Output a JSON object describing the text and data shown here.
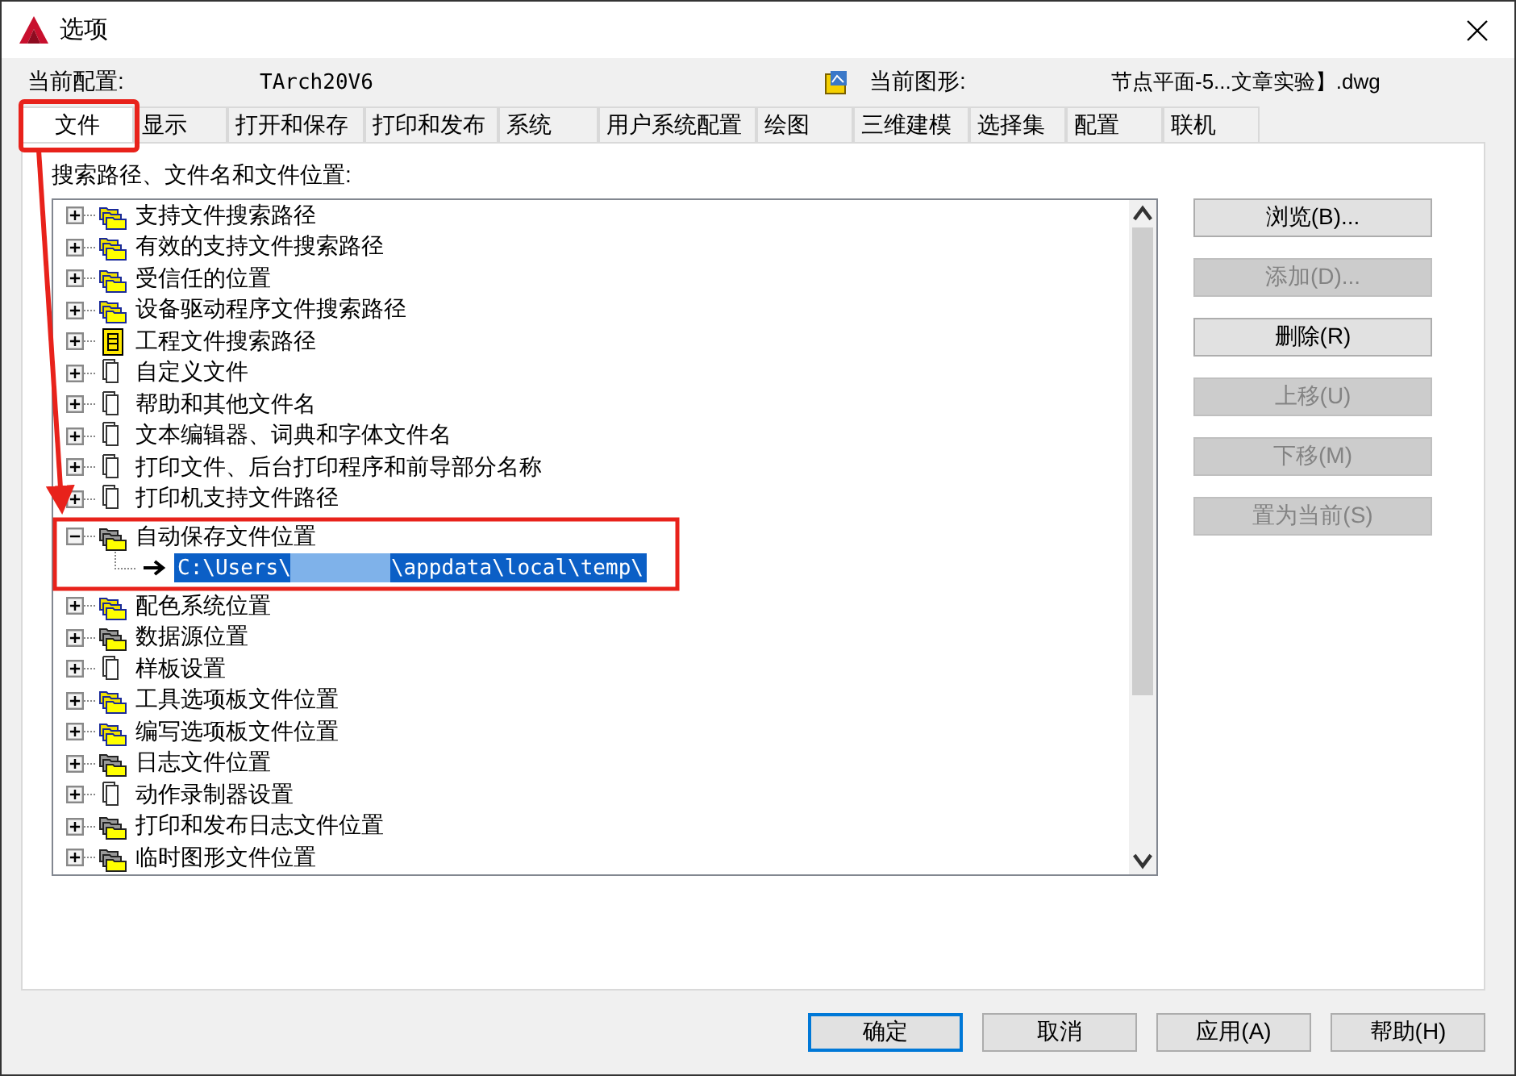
{
  "window": {
    "title": "选项"
  },
  "profile": {
    "label": "当前配置:",
    "value": "TArch20V6"
  },
  "drawing": {
    "label": "当前图形:",
    "value": "节点平面-5...文章实验】.dwg"
  },
  "tabs": [
    {
      "label": "文件",
      "selected": true,
      "marked": true
    },
    {
      "label": "显示",
      "selected": false
    },
    {
      "label": "打开和保存",
      "selected": false
    },
    {
      "label": "打印和发布",
      "selected": false
    },
    {
      "label": "系统",
      "selected": false
    },
    {
      "label": "用户系统配置",
      "selected": false
    },
    {
      "label": "绘图",
      "selected": false
    },
    {
      "label": "三维建模",
      "selected": false
    },
    {
      "label": "选择集",
      "selected": false
    },
    {
      "label": "配置",
      "selected": false
    },
    {
      "label": "联机",
      "selected": false
    }
  ],
  "tree_label": "搜索路径、文件名和文件位置:",
  "tree": [
    {
      "label": "支持文件搜索路径",
      "kind": "folders-blue",
      "expanded": false
    },
    {
      "label": "有效的支持文件搜索路径",
      "kind": "folders-blue",
      "expanded": false
    },
    {
      "label": "受信任的位置",
      "kind": "folders-blue",
      "expanded": false
    },
    {
      "label": "设备驱动程序文件搜索路径",
      "kind": "folders-blue",
      "expanded": false
    },
    {
      "label": "工程文件搜索路径",
      "kind": "project",
      "expanded": false
    },
    {
      "label": "自定义文件",
      "kind": "document",
      "expanded": false
    },
    {
      "label": "帮助和其他文件名",
      "kind": "document",
      "expanded": false
    },
    {
      "label": "文本编辑器、词典和字体文件名",
      "kind": "document",
      "expanded": false
    },
    {
      "label": "打印文件、后台打印程序和前导部分名称",
      "kind": "document",
      "expanded": false
    },
    {
      "label": "打印机支持文件路径",
      "kind": "document",
      "expanded": false
    },
    {
      "label": "自动保存文件位置",
      "kind": "folders-gray",
      "expanded": true,
      "marked": true,
      "children": [
        {
          "path_start": "C:\\Users\\",
          "path_end": "\\appdata\\local\\temp\\",
          "redacted": true,
          "selected": true
        }
      ]
    },
    {
      "label": "配色系统位置",
      "kind": "folders-blue",
      "expanded": false
    },
    {
      "label": "数据源位置",
      "kind": "folders-gray",
      "expanded": false
    },
    {
      "label": "样板设置",
      "kind": "document",
      "expanded": false
    },
    {
      "label": "工具选项板文件位置",
      "kind": "folders-blue",
      "expanded": false
    },
    {
      "label": "编写选项板文件位置",
      "kind": "folders-blue",
      "expanded": false
    },
    {
      "label": "日志文件位置",
      "kind": "folders-gray",
      "expanded": false
    },
    {
      "label": "动作录制器设置",
      "kind": "document",
      "expanded": false
    },
    {
      "label": "打印和发布日志文件位置",
      "kind": "folders-gray",
      "expanded": false
    },
    {
      "label": "临时图形文件位置",
      "kind": "folders-gray",
      "expanded": false
    }
  ],
  "side_buttons": [
    {
      "label": "浏览(B)...",
      "disabled": false
    },
    {
      "label": "添加(D)...",
      "disabled": true
    },
    {
      "label": "删除(R)",
      "disabled": false
    },
    {
      "label": "上移(U)",
      "disabled": true
    },
    {
      "label": "下移(M)",
      "disabled": true
    },
    {
      "label": "置为当前(S)",
      "disabled": true
    }
  ],
  "footer_buttons": [
    {
      "label": "确定",
      "default": true
    },
    {
      "label": "取消",
      "default": false
    },
    {
      "label": "应用(A)",
      "default": false
    },
    {
      "label": "帮助(H)",
      "default": false
    }
  ]
}
